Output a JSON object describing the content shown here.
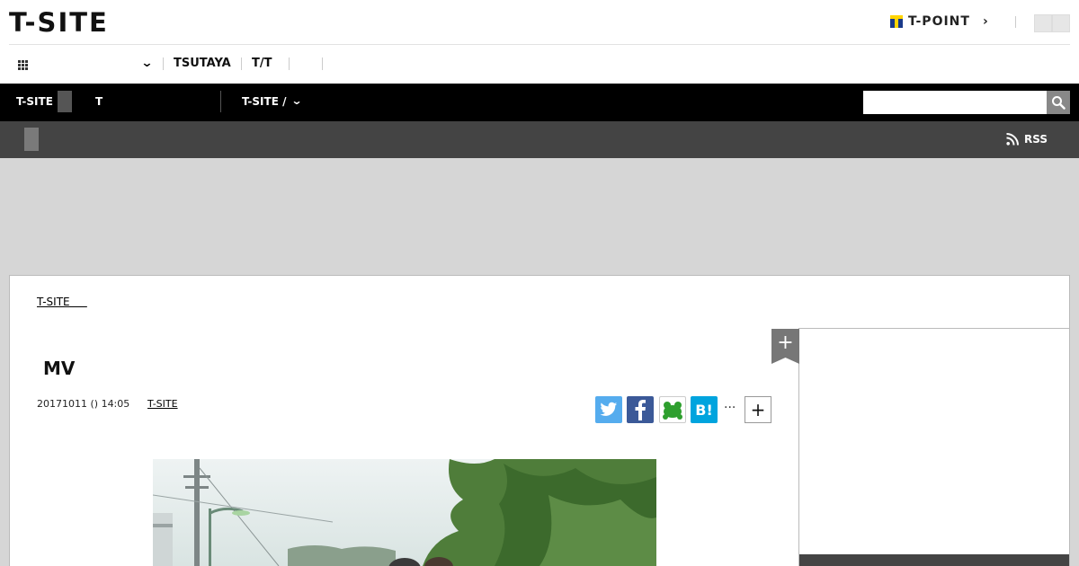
{
  "header": {
    "logo": "T-SITE",
    "tpoint_label": "T-POINT"
  },
  "service_nav": {
    "links": [
      "TSUTAYA",
      "T/T"
    ]
  },
  "main_nav": {
    "item1": "T-SITE",
    "item2": "T",
    "item3": "T-SITE /"
  },
  "search": {
    "placeholder": ""
  },
  "subnav": {
    "rss_label": "RSS"
  },
  "breadcrumb": {
    "label": "T-SITE"
  },
  "article": {
    "title": "MV",
    "date": "20171011 () 14:05",
    "category": "T-SITE",
    "more_label": "···"
  },
  "colors": {
    "twitter": "#55acee",
    "facebook": "#3b5998",
    "evernote_like": "#2e9f2e",
    "hatena": "#00a4de"
  }
}
